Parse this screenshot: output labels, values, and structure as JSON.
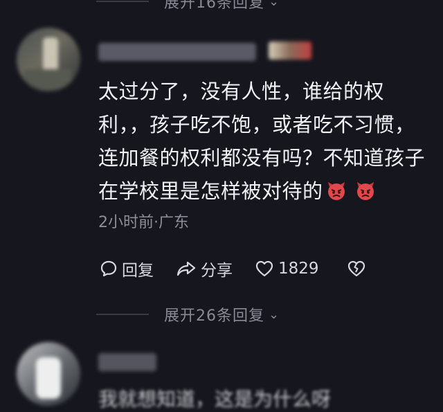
{
  "top_expand": {
    "label": "展开16条回复"
  },
  "comment": {
    "lines": [
      "太过分了，没有人性，谁给的权",
      "利，，孩子吃不饱，或者吃不习惯，",
      "连加餐的权利都没有吗？不知道孩子",
      "在学校里是怎样被对待的"
    ],
    "emoji": [
      "angry-devil-emoji",
      "angry-devil-emoji"
    ],
    "meta": "2小时前·广东",
    "reply_label": "回复",
    "share_label": "分享",
    "like_count": "1829"
  },
  "bottom_expand": {
    "label": "展开26条回复"
  },
  "next_comment": {
    "partial_text": "我就想知道，这是为什么呀"
  },
  "colors": {
    "background": "#16161e",
    "text": "#f1f1f5",
    "muted": "#8e8e9a",
    "emoji_red": "#e0494b"
  }
}
